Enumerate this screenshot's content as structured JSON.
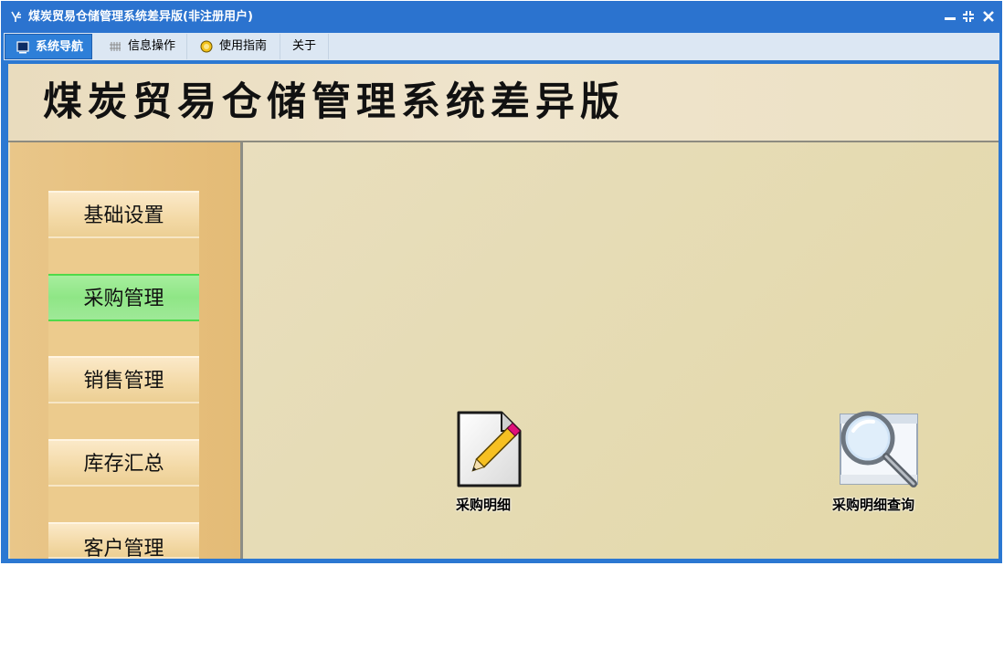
{
  "window": {
    "title": "煤炭贸易仓储管理系统差异版(非注册用户)",
    "app_icon": "app-logo-icon",
    "controls": [
      "minimize-icon",
      "restore-icon",
      "close-icon"
    ]
  },
  "menu": {
    "tabs": [
      {
        "label": "系统导航",
        "icon": "monitor-icon",
        "active": true
      },
      {
        "label": "信息操作",
        "icon": "grid-icon",
        "active": false
      },
      {
        "label": "使用指南",
        "icon": "help-circle-icon",
        "active": false
      },
      {
        "label": "关于",
        "icon": "",
        "active": false
      }
    ]
  },
  "header": {
    "title": "煤炭贸易仓储管理系统差异版"
  },
  "sidebar": {
    "items": [
      {
        "label": "基础设置",
        "active": false
      },
      {
        "label": "采购管理",
        "active": true
      },
      {
        "label": "销售管理",
        "active": false
      },
      {
        "label": "库存汇总",
        "active": false
      },
      {
        "label": "客户管理",
        "active": false
      }
    ]
  },
  "functions": [
    {
      "label": "采购明细",
      "icon": "edit-document-icon"
    },
    {
      "label": "采购明细查询",
      "icon": "magnifier-window-icon"
    }
  ],
  "colors": {
    "title_bar": "#2b73cf",
    "active_tab": "#2e7fd8",
    "active_nav": "#8fe686",
    "sidebar": "#e4bb76"
  }
}
